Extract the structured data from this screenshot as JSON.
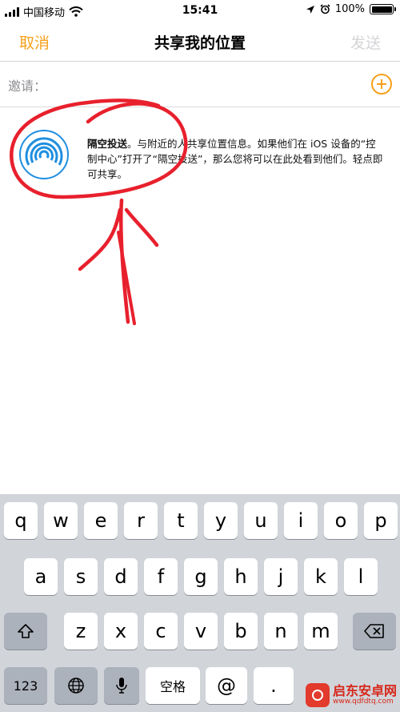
{
  "status_bar": {
    "carrier": "中国移动",
    "time": "15:41",
    "battery": "100%",
    "battery_level": 1.0,
    "icons": [
      "signal-icon",
      "wifi-icon",
      "location-arrow-icon",
      "alarm-icon",
      "battery-icon"
    ]
  },
  "nav": {
    "cancel_label": "取消",
    "title": "共享我的位置",
    "send_label": "发送"
  },
  "invite": {
    "label": "邀请：",
    "add_icon": "plus-circle-icon"
  },
  "airdrop": {
    "icon": "airdrop-icon",
    "title": "隔空投送",
    "body": "。与附近的人共享位置信息。如果他们在 iOS 设备的“控制中心”打开了“隔空投送”，那么您将可以在此处看到他们。轻点即可共享。"
  },
  "keyboard": {
    "row1": [
      "q",
      "w",
      "e",
      "r",
      "t",
      "y",
      "u",
      "i",
      "o",
      "p"
    ],
    "row2": [
      "a",
      "s",
      "d",
      "f",
      "g",
      "h",
      "j",
      "k",
      "l"
    ],
    "row3": [
      "z",
      "x",
      "c",
      "v",
      "b",
      "n",
      "m"
    ],
    "numbers_key": "123",
    "space_key": "空格",
    "at_key": "@",
    "dot_key": "."
  },
  "watermark": {
    "name": "启东安卓网",
    "url": "www.qdfdtq.com"
  },
  "colors": {
    "accent": "#f6a11c",
    "annotation": "#e8202d",
    "airdrop_blue": "#1f8fe0"
  }
}
